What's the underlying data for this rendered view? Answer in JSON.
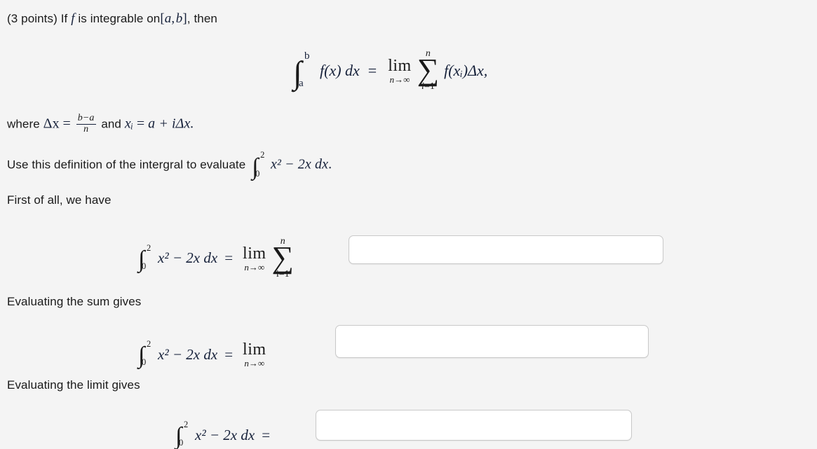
{
  "page": {
    "background_color": "#f4f4f4",
    "text_color": "#1a1a1a",
    "math_color": "#16213a"
  },
  "question": {
    "points_label": "(3 points)",
    "intro_before": "If",
    "intro_f": "f",
    "intro_after": "is integrable on",
    "interval_open": "[",
    "interval_a": "a",
    "interval_comma": ",",
    "interval_b": "b",
    "interval_close": "]",
    "intro_end": ", then"
  },
  "definition": {
    "integral_glyph": "∫",
    "upper_limit": "b",
    "lower_limit": "a",
    "integrand": "f(x) dx",
    "equals": "=",
    "lim_word": "lim",
    "lim_sub_var": "n",
    "lim_sub_arrow": "→",
    "lim_sub_target": "∞",
    "sum_glyph": "∑",
    "sum_upper": "n",
    "sum_lower_i": "i",
    "sum_lower_eq": "=",
    "sum_lower_one": "1",
    "summand": "f(xᵢ)Δx,"
  },
  "where_line": {
    "where_word": "where",
    "delta_x": "Δx",
    "equals1": "=",
    "frac_num": "b−a",
    "frac_den": "n",
    "and_word": "and",
    "x_sub_i": "xᵢ",
    "equals2": "=",
    "rhs": "a + iΔx."
  },
  "instruction": {
    "text": "Use this definition of the intergral to evaluate",
    "integral_glyph": "∫",
    "upper_limit": "2",
    "lower_limit": "0",
    "integrand": "x² − 2x dx",
    "period": "."
  },
  "steps": [
    {
      "id": "step-first",
      "label": "First of all, we have",
      "equation": {
        "integral_glyph": "∫",
        "upper_limit": "2",
        "lower_limit": "0",
        "integrand": "x² − 2x dx",
        "equals": "=",
        "lim_word": "lim",
        "lim_sub_var": "n",
        "lim_sub_arrow": "→",
        "lim_sub_target": "∞",
        "has_sum": true,
        "sum_glyph": "∑",
        "sum_upper": "n",
        "sum_lower": "i=1"
      },
      "input": {
        "value": "",
        "placeholder": ""
      }
    },
    {
      "id": "step-sum",
      "label": "Evaluating the sum gives",
      "equation": {
        "integral_glyph": "∫",
        "upper_limit": "2",
        "lower_limit": "0",
        "integrand": "x² − 2x dx",
        "equals": "=",
        "lim_word": "lim",
        "lim_sub_var": "n",
        "lim_sub_arrow": "→",
        "lim_sub_target": "∞",
        "has_sum": false
      },
      "input": {
        "value": "",
        "placeholder": ""
      }
    },
    {
      "id": "step-limit",
      "label": "Evaluating the limit gives",
      "equation": {
        "integral_glyph": "∫",
        "upper_limit": "2",
        "lower_limit": "0",
        "integrand": "x² − 2x dx",
        "equals": "=",
        "has_lim": false,
        "has_sum": false
      },
      "input": {
        "value": "",
        "placeholder": ""
      }
    }
  ]
}
